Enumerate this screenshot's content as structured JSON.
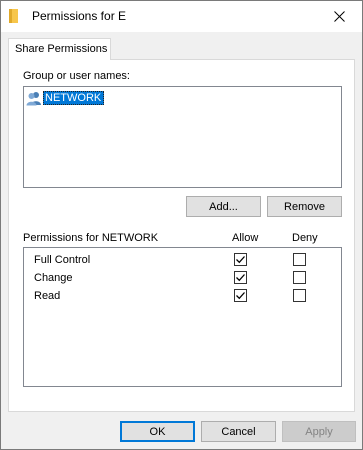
{
  "window": {
    "title": "Permissions for E",
    "close_label": "✕"
  },
  "tab": {
    "label": "Share Permissions"
  },
  "groups": {
    "label": "Group or user names:",
    "items": [
      {
        "name": "NETWORK",
        "icon": "users-icon",
        "selected": true
      }
    ]
  },
  "buttons": {
    "add": "Add...",
    "remove": "Remove",
    "ok": "OK",
    "cancel": "Cancel",
    "apply": "Apply"
  },
  "permissions": {
    "header": "Permissions for NETWORK",
    "allow_header": "Allow",
    "deny_header": "Deny",
    "rows": [
      {
        "name": "Full Control",
        "allow": true,
        "deny": false
      },
      {
        "name": "Change",
        "allow": true,
        "deny": false
      },
      {
        "name": "Read",
        "allow": true,
        "deny": false
      }
    ]
  },
  "colors": {
    "selection": "#0078d7",
    "accent": "#0078d7"
  }
}
